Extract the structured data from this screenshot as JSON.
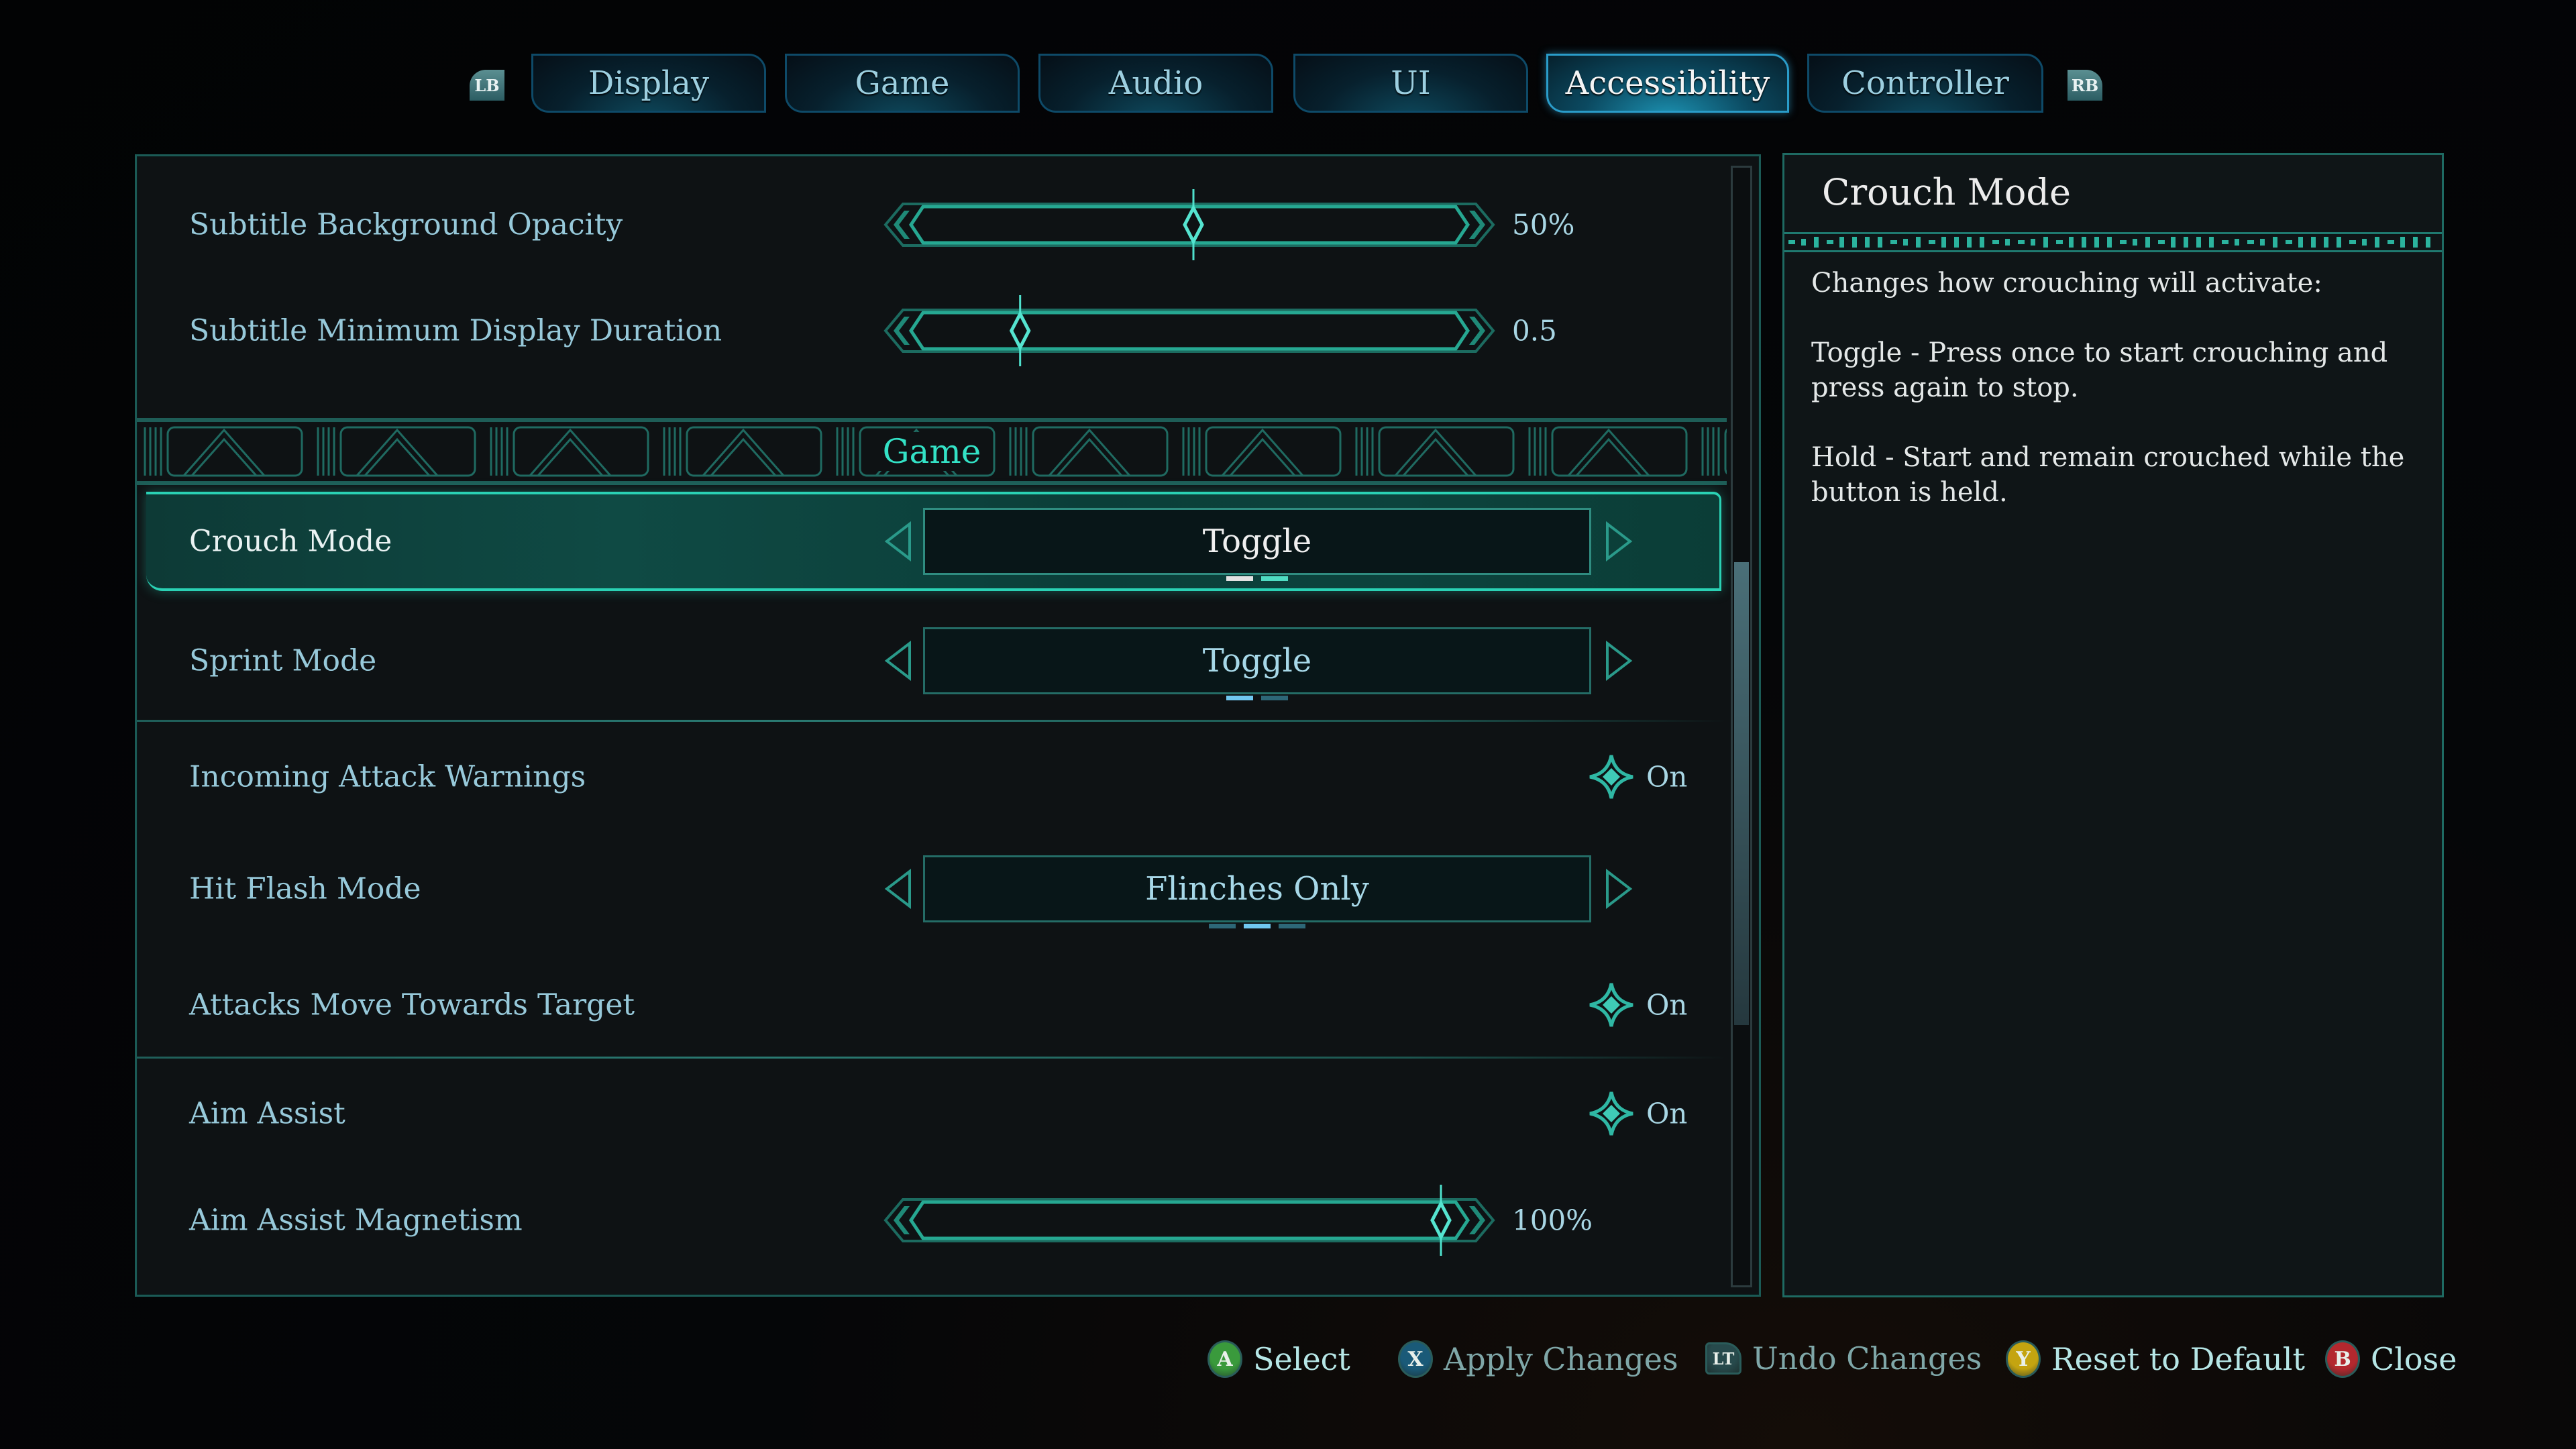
{
  "tabs": {
    "left_bumper": "LB",
    "right_bumper": "RB",
    "items": [
      {
        "label": "Display",
        "active": false
      },
      {
        "label": "Game",
        "active": false
      },
      {
        "label": "Audio",
        "active": false
      },
      {
        "label": "UI",
        "active": false
      },
      {
        "label": "Accessibility",
        "active": true
      },
      {
        "label": "Controller",
        "active": false
      }
    ]
  },
  "settings": {
    "section_title": "Game",
    "rows": [
      {
        "label": "Subtitle Background Opacity",
        "type": "slider",
        "value": "50%",
        "fraction": 0.5
      },
      {
        "label": "Subtitle Minimum Display Duration",
        "type": "slider",
        "value": "0.5",
        "fraction": 0.15
      },
      {
        "label": "Crouch Mode",
        "type": "selector",
        "value": "Toggle",
        "option_count": 2,
        "option_index": 0,
        "focused": true
      },
      {
        "label": "Sprint Mode",
        "type": "selector",
        "value": "Toggle",
        "option_count": 2,
        "option_index": 0
      },
      {
        "label": "Incoming Attack Warnings",
        "type": "checkbox",
        "value": "On"
      },
      {
        "label": "Hit Flash Mode",
        "type": "selector",
        "value": "Flinches Only",
        "option_count": 3,
        "option_index": 1
      },
      {
        "label": "Attacks Move Towards Target",
        "type": "checkbox",
        "value": "On"
      },
      {
        "label": "Aim Assist",
        "type": "checkbox",
        "value": "On"
      },
      {
        "label": "Aim Assist Magnetism",
        "type": "slider",
        "value": "100%",
        "fraction": 1.0
      }
    ],
    "scroll_position": 0.6
  },
  "description": {
    "title": "Crouch Mode",
    "paragraphs": [
      "Changes how crouching will activate:",
      "Toggle - Press once to start crouching and press again to stop.",
      "Hold - Start and remain crouched while the button is held."
    ]
  },
  "hints": [
    {
      "button": "A",
      "label": "Select",
      "color": "#3a9a3c",
      "dim": false
    },
    {
      "button": "X",
      "label": "Apply Changes",
      "color": "#1a5a78",
      "dim": true
    },
    {
      "button": "LT",
      "label": "Undo Changes",
      "color": "#274a4c",
      "dim": true
    },
    {
      "button": "Y",
      "label": "Reset to Default",
      "color": "#c4a410",
      "dim": false
    },
    {
      "button": "B",
      "label": "Close",
      "color": "#b3282e",
      "dim": false
    }
  ],
  "colors": {
    "accent_teal": "#2ad1b4",
    "tab_active_border": "#2a9cc9",
    "label_text": "#97c9da"
  }
}
